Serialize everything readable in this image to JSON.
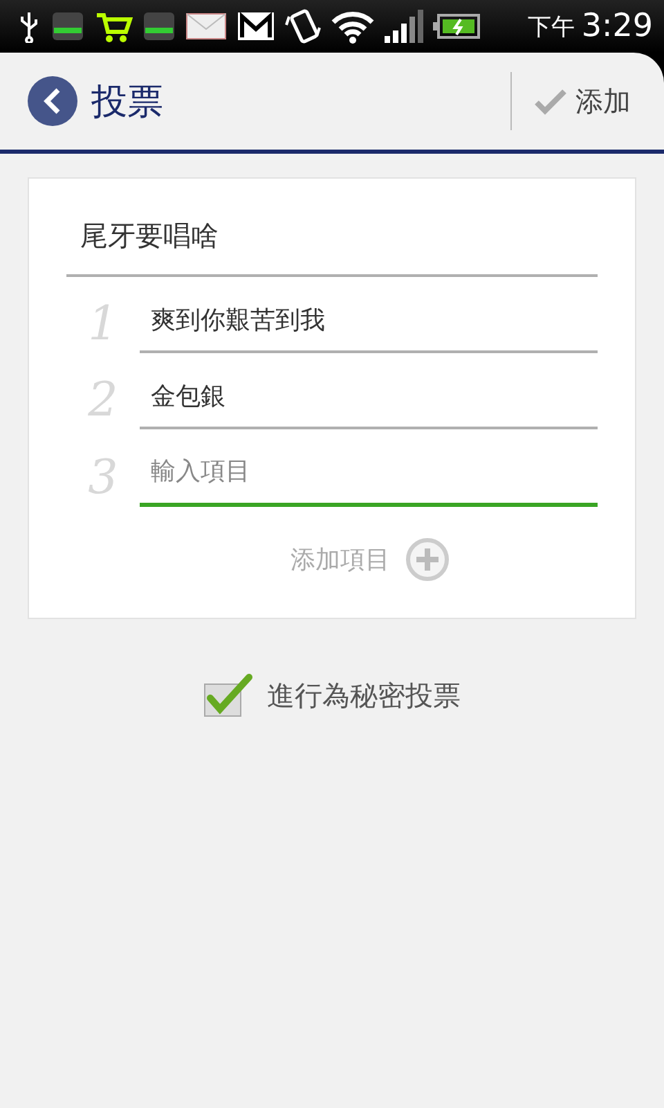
{
  "status_bar": {
    "ampm": "下午",
    "time": "3:29"
  },
  "header": {
    "title": "投票",
    "action": "添加"
  },
  "poll": {
    "question": "尾牙要唱啥",
    "options": [
      {
        "number": "1",
        "value": "爽到你艱苦到我",
        "focused": false
      },
      {
        "number": "2",
        "value": "金包銀",
        "focused": false
      },
      {
        "number": "3",
        "placeholder": "輸入項目",
        "focused": true
      }
    ],
    "add_option": "添加項目"
  },
  "secret": {
    "label": "進行為秘密投票",
    "checked": true
  }
}
